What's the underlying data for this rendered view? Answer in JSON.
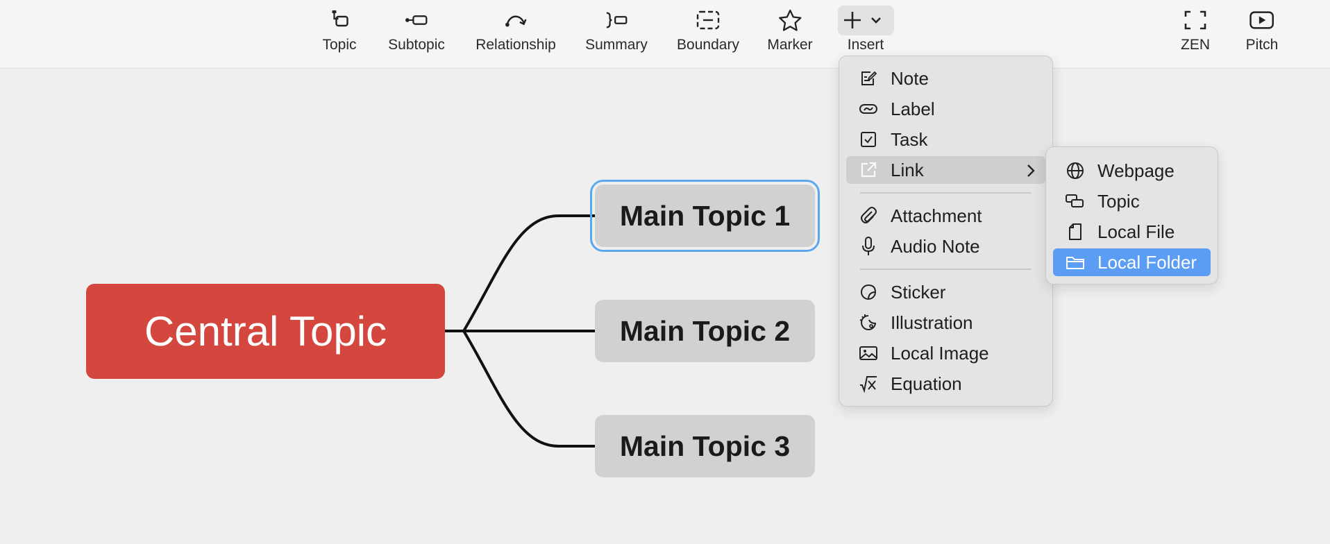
{
  "toolbar": {
    "items": [
      {
        "label": "Topic",
        "icon": "topic-icon"
      },
      {
        "label": "Subtopic",
        "icon": "subtopic-icon"
      },
      {
        "label": "Relationship",
        "icon": "relationship-icon"
      },
      {
        "label": "Summary",
        "icon": "summary-icon"
      },
      {
        "label": "Boundary",
        "icon": "boundary-icon"
      },
      {
        "label": "Marker",
        "icon": "star-icon"
      },
      {
        "label": "Insert",
        "icon": "plus-icon"
      },
      {
        "label": "ZEN",
        "icon": "zen-icon"
      },
      {
        "label": "Pitch",
        "icon": "play-icon"
      }
    ]
  },
  "mindmap": {
    "central_topic": "Central Topic",
    "main_topics": [
      "Main Topic 1",
      "Main Topic 2",
      "Main Topic 3"
    ],
    "selected_topic_index": 0
  },
  "insert_menu": {
    "items": [
      {
        "label": "Note",
        "icon": "note-icon"
      },
      {
        "label": "Label",
        "icon": "label-icon"
      },
      {
        "label": "Task",
        "icon": "task-checkbox-icon"
      },
      {
        "label": "Link",
        "icon": "link-icon",
        "has_submenu": true,
        "highlighted": true
      },
      {
        "label": "Attachment",
        "icon": "paperclip-icon"
      },
      {
        "label": "Audio Note",
        "icon": "microphone-icon"
      },
      {
        "label": "Sticker",
        "icon": "sticker-icon"
      },
      {
        "label": "Illustration",
        "icon": "illustration-icon"
      },
      {
        "label": "Local Image",
        "icon": "image-icon"
      },
      {
        "label": "Equation",
        "icon": "equation-icon"
      }
    ]
  },
  "link_submenu": {
    "items": [
      {
        "label": "Webpage",
        "icon": "globe-icon"
      },
      {
        "label": "Topic",
        "icon": "topic-link-icon"
      },
      {
        "label": "Local File",
        "icon": "file-icon"
      },
      {
        "label": "Local Folder",
        "icon": "folder-icon",
        "selected": true
      }
    ]
  },
  "colors": {
    "central_topic_bg": "#d4473f",
    "main_topic_bg": "#d1d1d1",
    "selection_outline": "#5aa7ee",
    "menu_active_bg": "#5b9cf5",
    "canvas_bg": "#efefef"
  }
}
